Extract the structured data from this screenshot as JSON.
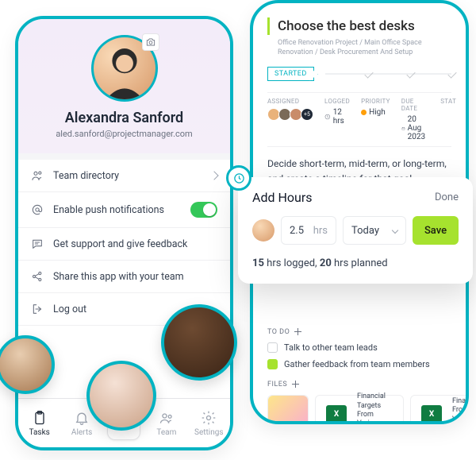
{
  "colors": {
    "accent": "#02b3c2",
    "lime": "#a6e22e",
    "toggle_on": "#34c759",
    "priority_high": "#ff9f0a"
  },
  "profile": {
    "name": "Alexandra Sanford",
    "email": "aled.sanford@projectmanager.com"
  },
  "menu": {
    "items": [
      {
        "id": "team-directory",
        "label": "Team directory",
        "icon": "users-icon",
        "accessory": "chevron"
      },
      {
        "id": "push-notifications",
        "label": "Enable push notifications",
        "icon": "at-icon",
        "accessory": "toggle",
        "toggle_on": true
      },
      {
        "id": "support-feedback",
        "label": "Get support and give feedback",
        "icon": "chat-icon",
        "accessory": "none"
      },
      {
        "id": "share-app",
        "label": "Share this app with your team",
        "icon": "share-icon",
        "accessory": "none"
      },
      {
        "id": "log-out",
        "label": "Log out",
        "icon": "logout-icon",
        "accessory": "none"
      }
    ]
  },
  "tabs": {
    "items": [
      {
        "id": "tasks",
        "label": "Tasks",
        "active": true
      },
      {
        "id": "alerts",
        "label": "Alerts",
        "active": false
      },
      {
        "id": "add",
        "label": "",
        "active": false
      },
      {
        "id": "team",
        "label": "Team",
        "active": false
      },
      {
        "id": "settings",
        "label": "Settings",
        "active": false
      }
    ]
  },
  "task": {
    "title": "Choose the best desks",
    "breadcrumb": "Office Renovation Project / Main Office Space Renovation / Desk Procurement And Setup",
    "status": "STARTED",
    "meta": {
      "assigned_label": "ASSIGNED",
      "assigned_more": "+5",
      "logged_label": "LOGGED",
      "logged_value": "12 hrs",
      "priority_label": "PRIORITY",
      "priority_value": "High",
      "due_label": "DUE DATE",
      "due_value": "20 Aug 2023",
      "status_label": "STAT"
    },
    "description": "Decide short-term, mid-term, or long-term, and create a timeline for that goal. Determine how much money you need to reach your goal and",
    "todo_header": "TO DO",
    "todo": [
      {
        "label": "Talk to other team leads",
        "done": false
      },
      {
        "label": "Gather feedback from team members",
        "done": true
      }
    ],
    "files_header": "FILES",
    "files": [
      {
        "name": "(image)",
        "kind": "image"
      },
      {
        "name": "Financial Targets From Various Teams.Pdf",
        "kind": "excel"
      },
      {
        "name": "Financial From Vario Teams.Pd",
        "kind": "excel"
      }
    ]
  },
  "add_hours": {
    "title": "Add Hours",
    "done_label": "Done",
    "hours_value": "2.5",
    "hours_unit": "hrs",
    "date_value": "Today",
    "save_label": "Save",
    "summary_logged": "15",
    "summary_planned": "20",
    "summary_logged_suffix": "hrs logged,",
    "summary_planned_suffix": "hrs planned"
  }
}
